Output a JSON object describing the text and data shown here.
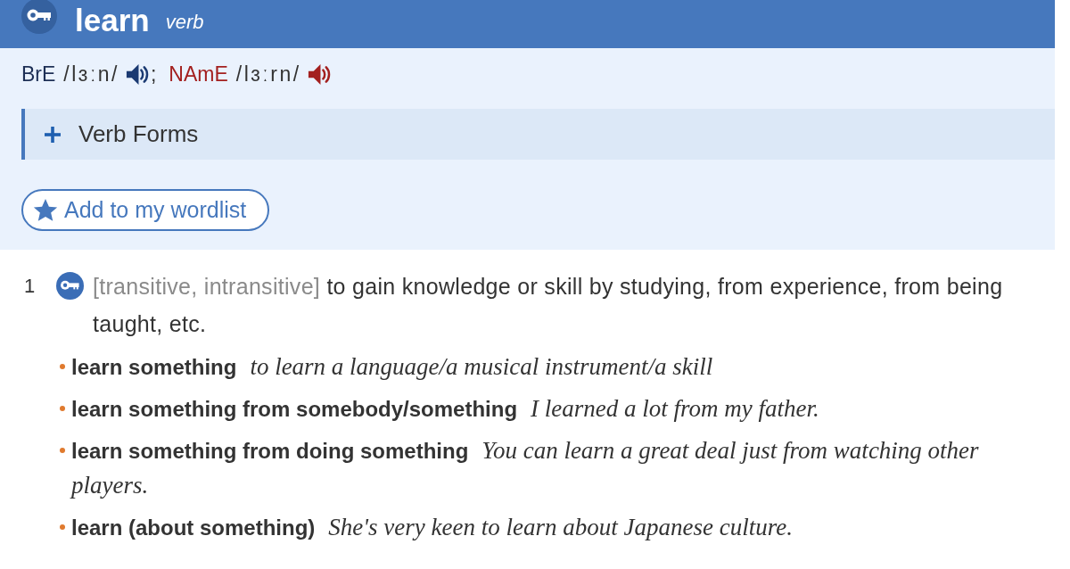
{
  "header": {
    "headword": "learn",
    "part_of_speech": "verb"
  },
  "pronunciations": [
    {
      "kind": "british",
      "label": "BrE",
      "transcription": "/lɜːn/",
      "separator": ";"
    },
    {
      "kind": "american",
      "label": "NAmE",
      "transcription": "/lɜːrn/"
    }
  ],
  "verb_forms": {
    "label": "Verb Forms",
    "expanded": false
  },
  "wordlist_button": {
    "label": "Add to my wordlist"
  },
  "senses": [
    {
      "number": "1",
      "grammar": "[transitive, intransitive]",
      "definition": "to gain knowledge or skill by studying, from experience, from being taught, etc.",
      "examples": [
        {
          "pattern": "learn something",
          "example": "to learn a language/a musical instrument/a skill"
        },
        {
          "pattern": "learn something from somebody/something",
          "example": "I learned a lot from my father."
        },
        {
          "pattern": "learn something from doing something",
          "example": "You can learn a great deal just from watching other players."
        },
        {
          "pattern": "learn (about something)",
          "example": "She's very keen to learn about Japanese culture."
        }
      ]
    }
  ]
}
